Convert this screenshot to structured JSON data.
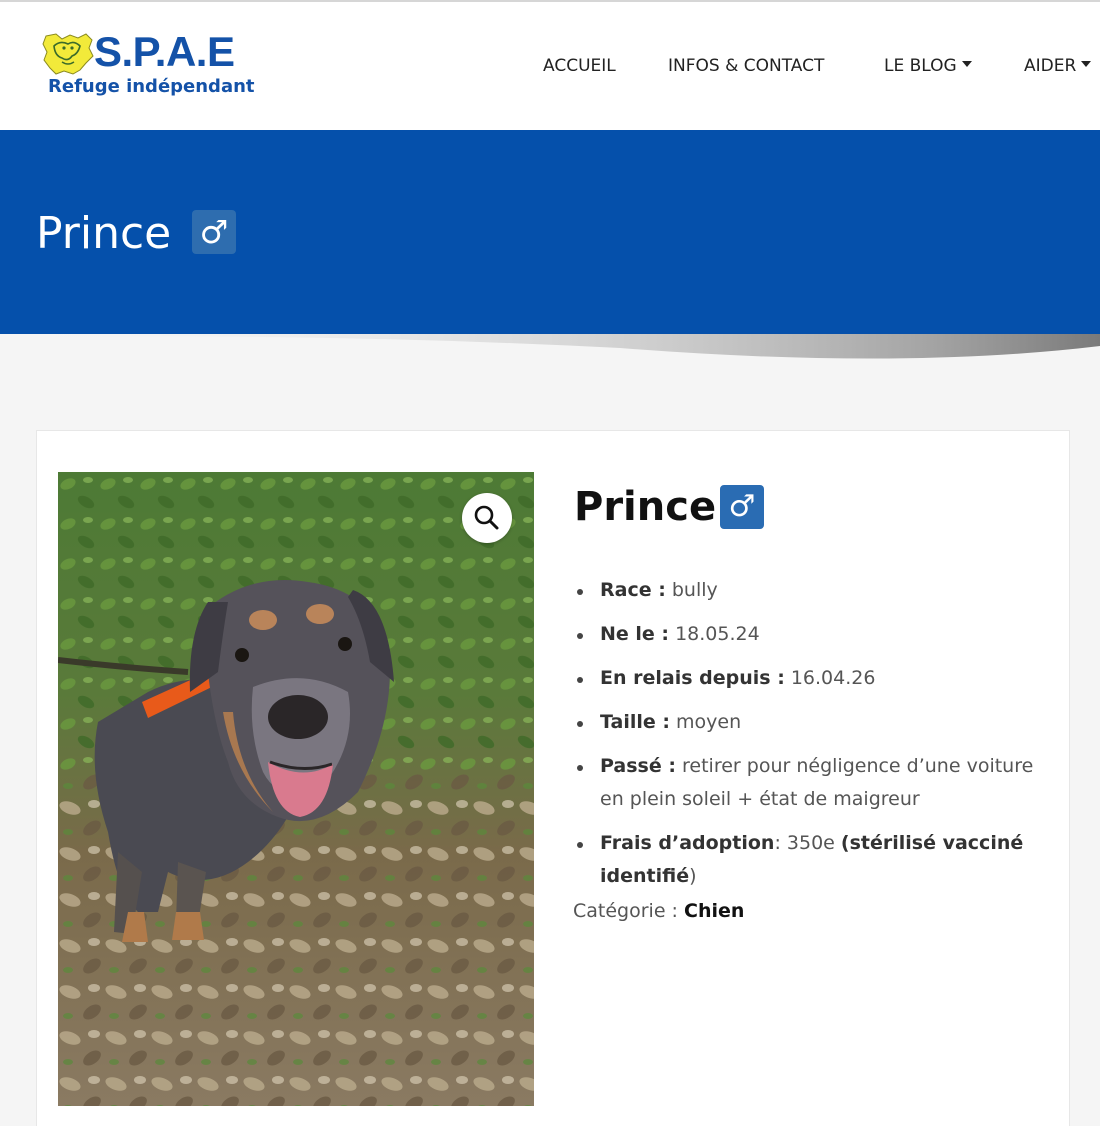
{
  "header": {
    "logo": {
      "name": "S.P.A.E",
      "tagline": "Refuge indépendant"
    },
    "nav": [
      {
        "label": "ACCUEIL",
        "dropdown": false
      },
      {
        "label": "INFOS & CONTACT",
        "dropdown": false
      },
      {
        "label": "LE BLOG",
        "dropdown": true
      },
      {
        "label": "AIDER",
        "dropdown": true
      }
    ]
  },
  "banner": {
    "title": "Prince",
    "gender_symbol": "♂"
  },
  "product": {
    "title": "Prince",
    "gender_symbol": "♂",
    "image_alt": "Photo de Prince, chien bully dans les feuilles",
    "details": [
      {
        "label": "Race :",
        "value": "bully"
      },
      {
        "label": "Ne le :",
        "value": "18.05.24"
      },
      {
        "label": "En relais depuis :",
        "value": "16.04.26"
      },
      {
        "label": "Taille :",
        "value": "moyen"
      },
      {
        "label": "Passé :",
        "value": "retirer pour négligence d’une voiture en plein soleil + état de maigreur"
      },
      {
        "label": "Frais d’adoption",
        "value": ": 350e ",
        "bold_extra": "(stérilisé vacciné identifié",
        "tail": ")"
      }
    ],
    "category_label": "Catégorie : ",
    "category_value": "Chien"
  },
  "colors": {
    "brand_blue": "#0550ab",
    "badge_blue": "#2a6cb3",
    "logo_yellow": "#f2ea3a"
  },
  "icons": {
    "zoom": "magnifier-icon",
    "gender": "male-symbol"
  }
}
